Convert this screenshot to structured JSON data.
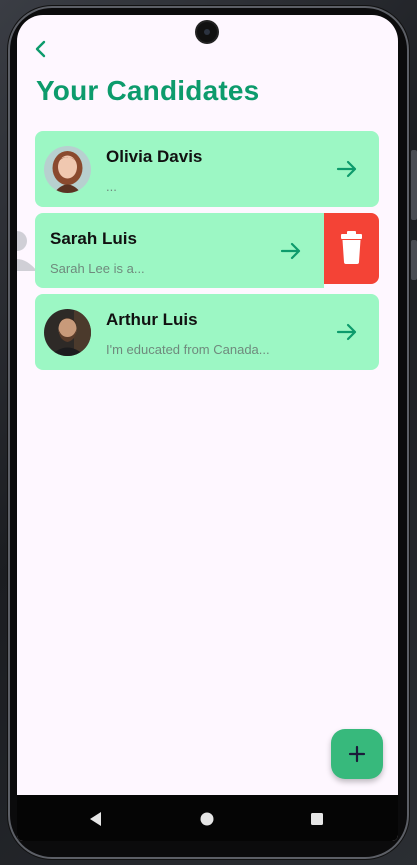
{
  "header": {
    "title": "Your Candidates",
    "back_icon": "chevron-left-icon"
  },
  "candidates": [
    {
      "name": "Olivia Davis",
      "description": "...",
      "has_photo": true
    },
    {
      "name": "Sarah Luis",
      "description": "Sarah Lee is a...",
      "has_photo": false,
      "swiped": true
    },
    {
      "name": "Arthur Luis",
      "description": "I'm educated from Canada...",
      "has_photo": true
    }
  ],
  "actions": {
    "delete_icon": "trash-icon",
    "add_icon": "plus-icon",
    "open_icon": "arrow-right-icon"
  },
  "colors": {
    "accent": "#0d9b6c",
    "card_background": "#9cf7c4",
    "delete": "#f44336",
    "fab": "#37b97c",
    "screen_background": "#fef7ff"
  },
  "system_nav": {
    "back_icon": "nav-back-icon",
    "home_icon": "nav-home-icon",
    "recents_icon": "nav-recents-icon"
  }
}
